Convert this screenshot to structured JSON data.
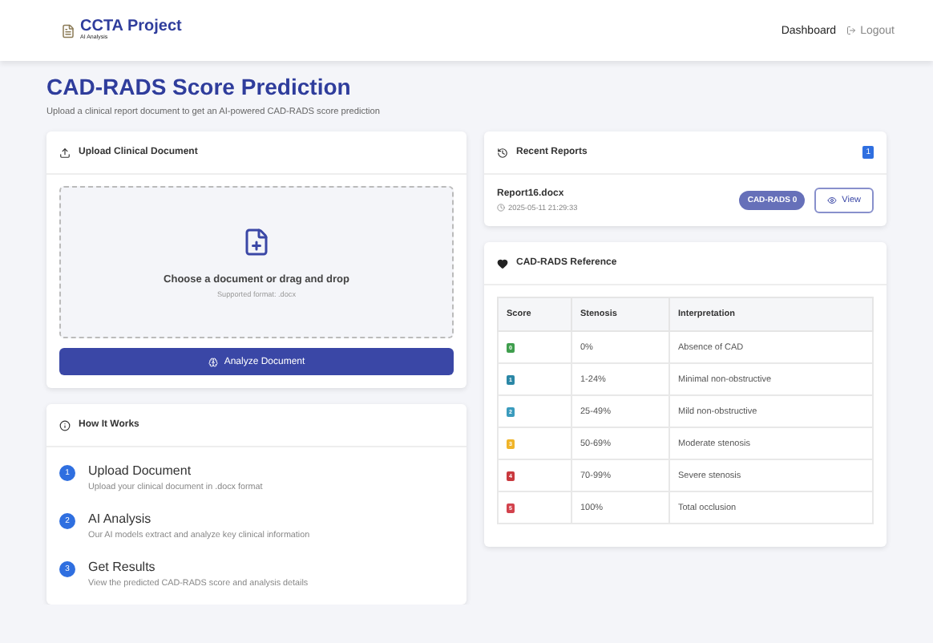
{
  "header": {
    "brand": "CCTA Project",
    "tagline": "AI Analysis",
    "nav": [
      {
        "label": "Dashboard",
        "kind": "link"
      },
      {
        "label": "Logout",
        "kind": "logout"
      }
    ]
  },
  "page": {
    "title": "CAD-RADS Score Prediction",
    "subtitle": "Upload a clinical report document to get an AI-powered CAD-RADS score prediction"
  },
  "upload": {
    "title": "Upload Clinical Document",
    "prompt": "Choose a document or drag and drop",
    "hint": "Supported format: .docx",
    "button": "Analyze Document"
  },
  "how_it_works": {
    "title": "How It Works",
    "steps": [
      {
        "number": "1",
        "title": "Upload Document",
        "text": "Upload your clinical document in .docx format"
      },
      {
        "number": "2",
        "title": "AI Analysis",
        "text": "Our AI models extract and analyze key clinical information"
      },
      {
        "number": "3",
        "title": "Get Results",
        "text": "View the predicted CAD-RADS score and analysis details"
      }
    ]
  },
  "recent_reports": {
    "title": "Recent Reports",
    "count": "1",
    "reports": [
      {
        "name": "Report16.docx",
        "time": "2025-05-11 21:29:33",
        "score": "CAD-RADS 0",
        "action": "View"
      }
    ]
  },
  "reference": {
    "title": "CAD-RADS Reference",
    "columns": [
      "Score",
      "Stenosis",
      "Interpretation"
    ],
    "rows": [
      {
        "score": "0",
        "color": "#3f9e4d",
        "stenosis": "0%",
        "interpretation": "Absence of CAD"
      },
      {
        "score": "1",
        "color": "#2b87a6",
        "stenosis": "1-24%",
        "interpretation": "Minimal non-obstructive"
      },
      {
        "score": "2",
        "color": "#3a9bbd",
        "stenosis": "25-49%",
        "interpretation": "Mild non-obstructive"
      },
      {
        "score": "3",
        "color": "#f0b429",
        "stenosis": "50-69%",
        "interpretation": "Moderate stenosis"
      },
      {
        "score": "4",
        "color": "#c9393e",
        "stenosis": "70-99%",
        "interpretation": "Severe stenosis"
      },
      {
        "score": "5",
        "color": "#d2424c",
        "stenosis": "100%",
        "interpretation": "Total occlusion"
      }
    ]
  }
}
